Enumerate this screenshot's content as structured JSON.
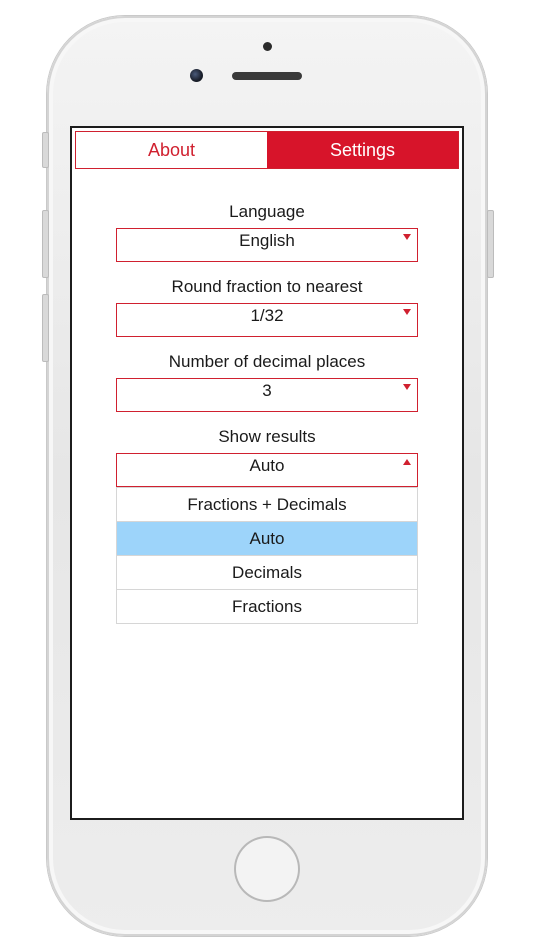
{
  "tabs": {
    "about_label": "About",
    "settings_label": "Settings"
  },
  "settings": {
    "language": {
      "label": "Language",
      "value": "English"
    },
    "round_fraction": {
      "label": "Round fraction to nearest",
      "value": "1/32"
    },
    "decimal_places": {
      "label": "Number of decimal places",
      "value": "3"
    },
    "show_results": {
      "label": "Show results",
      "value": "Auto",
      "options": [
        "Fractions + Decimals",
        "Auto",
        "Decimals",
        "Fractions"
      ],
      "selected_option": "Auto"
    }
  },
  "colors": {
    "accent": "#d7142a",
    "selection": "#9dd4fa"
  },
  "icons": {
    "dropdown_closed": "chevron-down-icon",
    "dropdown_open": "chevron-up-icon"
  }
}
